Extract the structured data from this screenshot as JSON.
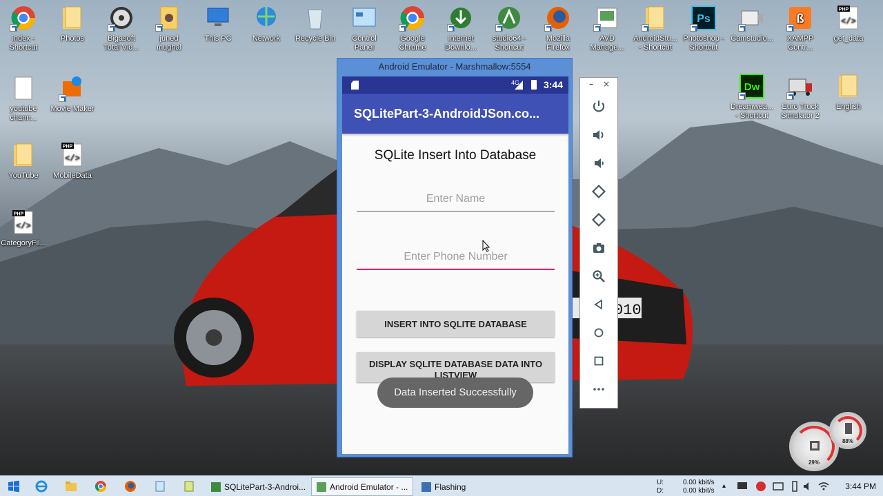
{
  "desktop": {
    "icons_row1": [
      {
        "label": "index -\nShortcut",
        "icon": "chrome-icon"
      },
      {
        "label": "Photos",
        "icon": "folder-icon"
      },
      {
        "label": "Bigasoft\nTotal Vid...",
        "icon": "film-reel-icon"
      },
      {
        "label": "juned\nmughal",
        "icon": "user-folder-icon"
      },
      {
        "label": "This PC",
        "icon": "computer-icon"
      },
      {
        "label": "Network",
        "icon": "network-globe-icon"
      },
      {
        "label": "Recycle Bin",
        "icon": "recycle-bin-icon"
      },
      {
        "label": "Control\nPanel",
        "icon": "control-panel-icon"
      },
      {
        "label": "Google\nChrome",
        "icon": "chrome-icon"
      },
      {
        "label": "Internet\nDownlo...",
        "icon": "download-manager-icon"
      },
      {
        "label": "studio64 -\nShortcut",
        "icon": "android-studio-icon"
      },
      {
        "label": "Mozilla\nFirefox",
        "icon": "firefox-icon"
      },
      {
        "label": "AVD\nManage...",
        "icon": "avd-manager-icon"
      },
      {
        "label": "AndroidStu...\n- Shortcut",
        "icon": "folder-icon"
      },
      {
        "label": "Photoshop -\nShortcut",
        "icon": "photoshop-icon"
      },
      {
        "label": "Camstudio...",
        "icon": "camstudio-icon"
      },
      {
        "label": "XAMPP\nContr...",
        "icon": "xampp-icon"
      },
      {
        "label": "get_data",
        "icon": "php-file-icon"
      }
    ],
    "icons_left": [
      {
        "label": "youtube\nchann...",
        "icon": "text-file-icon"
      },
      {
        "label": "Movie Maker",
        "icon": "movie-maker-icon"
      },
      {
        "label": "YouTube",
        "icon": "folder-icon"
      },
      {
        "label": "MobileData",
        "icon": "php-file-icon"
      },
      {
        "label": "CategoryFil...",
        "icon": "php-file-icon"
      }
    ],
    "icons_right": [
      {
        "label": "Dreamwea...\n- Shortcut",
        "icon": "dreamweaver-icon"
      },
      {
        "label": "Euro Truck\nSimulator 2",
        "icon": "truck-icon"
      },
      {
        "label": "English",
        "icon": "folder-icon"
      }
    ],
    "php_badge": "PHP",
    "ps_badge": "Ps",
    "dw_badge": "Dw"
  },
  "emulator": {
    "window_title": "Android Emulator - Marshmallow:5554",
    "status": {
      "signal": "4G",
      "time": "3:44"
    },
    "app_title": "SQLitePart-3-AndroidJSon.co...",
    "screen_title": "SQLite Insert Into Database",
    "name_placeholder": "Enter Name",
    "phone_placeholder": "Enter Phone Number",
    "insert_button": "INSERT INTO SQLITE DATABASE",
    "display_button": "DISPLAY SQLITE DATABASE DATA INTO LISTVIEW",
    "toast": "Data Inserted Successfully",
    "toolbar": {
      "minimize": "–",
      "close": "×"
    }
  },
  "gauges": {
    "cpu_percent": "29%",
    "memory_percent": "88%"
  },
  "taskbar": {
    "tasks": [
      {
        "label": "SQLitePart-3-Androi...",
        "active": false
      },
      {
        "label": "Android Emulator - ...",
        "active": true
      },
      {
        "label": "Flashing",
        "active": false
      }
    ],
    "net_up_label": "U:",
    "net_down_label": "D:",
    "net_up": "0.00 kbit/s",
    "net_down": "0.00 kbit/s",
    "clock": "3:44 PM"
  },
  "colors": {
    "android_primary": "#3f51b5",
    "android_primary_dark": "#283593",
    "accent": "#e91e63",
    "emulator_frame": "#5b8fd6"
  }
}
